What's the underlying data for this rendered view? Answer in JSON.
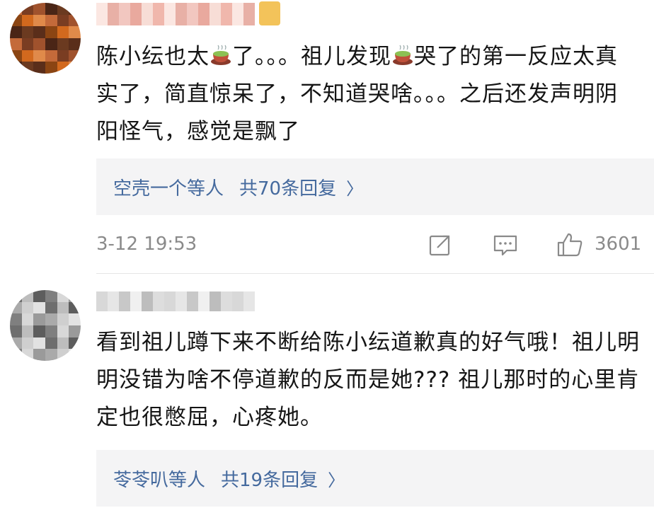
{
  "comments": [
    {
      "text_parts": [
        "陈小纭也太",
        "了。。。祖儿发现",
        "哭了的第一反应太真实了，简直惊呆了，不知道哭啥。。。之后还发声明阴阳怪气，感觉是飘了"
      ],
      "emoji_icon": "tea-cup-icon",
      "reply_names": "空壳一个等人",
      "reply_count": "共70条回复",
      "chevron": "〉",
      "time": "3-12 19:53",
      "like_count": "3601"
    },
    {
      "text": "看到祖儿蹲下来不断给陈小纭道歉真的好气哦！祖儿明明没错为啥不停道歉的反而是她??? 祖儿那时的心里肯定也很憋屈，心疼她。",
      "reply_names": "苓苓叭等人",
      "reply_count": "共19条回复",
      "chevron": "〉"
    }
  ],
  "colors": {
    "link": "#456a9e",
    "meta": "#8a8a8a",
    "reply_bg": "#f4f4f5"
  }
}
